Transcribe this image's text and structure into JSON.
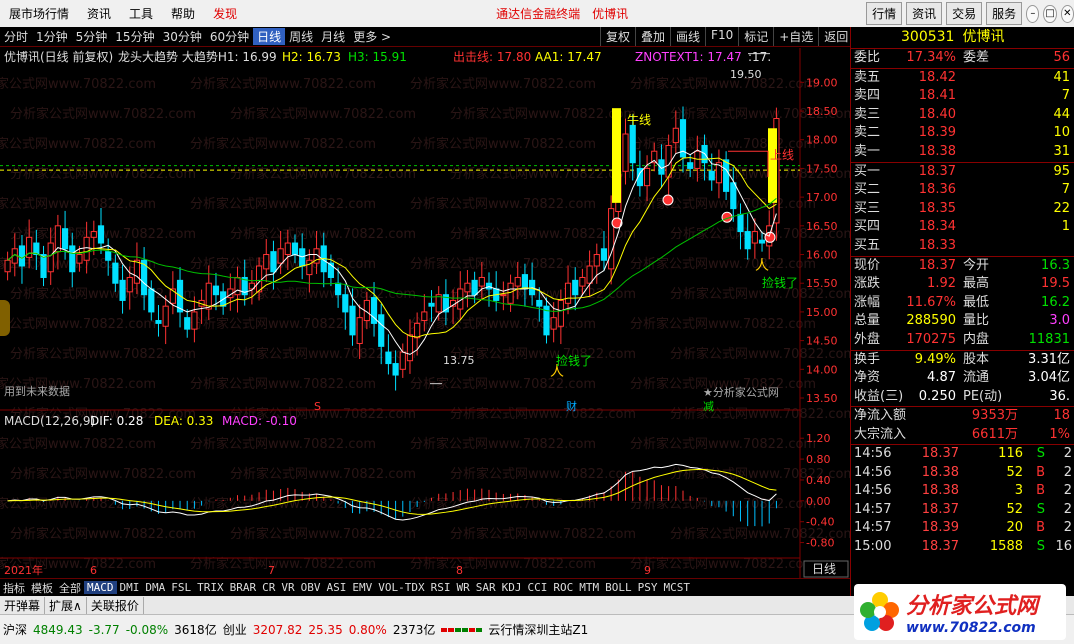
{
  "menubar": {
    "items": [
      "展市场行情",
      "资讯",
      "工具",
      "帮助"
    ],
    "discover": "发现",
    "center_title": "通达信金融终端",
    "center_stock": "优博讯",
    "right_buttons": [
      "行情",
      "资讯",
      "交易",
      "服务"
    ]
  },
  "periodbar": {
    "periods": [
      "分时",
      "1分钟",
      "5分钟",
      "15分钟",
      "30分钟",
      "60分钟",
      "日线",
      "周线",
      "月线",
      "更多 >"
    ],
    "selected": "日线",
    "tools": [
      "复权",
      "叠加",
      "画线",
      "F10",
      "标记",
      "+自选",
      "返回"
    ]
  },
  "chart_info": {
    "title": "优博讯(日线 前复权)",
    "indicator": "龙头大趋势 大趋势H1: 16.99",
    "h2": "H2: 16.73",
    "h3": "H3: 15.91",
    "chuji": "出击线: 17.80",
    "aa1": "AA1: 17.47",
    "znotext": "ZNOTEXT1: 17.47",
    "znotext_trail": ":17.",
    "high_label": "19.50",
    "low_label": "13.75",
    "bull_label": "牛线",
    "rise_label": "上线",
    "jianqian1": "捡钱了",
    "jianqian2": "捡钱了",
    "future_note": "用到未来数据",
    "site_note": "★分析家公式网",
    "mark_s": "S",
    "mark_cai": "财",
    "mark_jian": "减",
    "watermark": "分析家公式网www.70822.com",
    "price_ticks": [
      "19.00",
      "18.50",
      "18.00",
      "17.50",
      "17.00",
      "16.50",
      "16.00",
      "15.50",
      "15.00",
      "14.50",
      "14.00",
      "13.50"
    ]
  },
  "macd": {
    "title": "MACD(12,26,9)",
    "dif": "DIF: 0.28",
    "dea": "DEA: 0.33",
    "macd": "MACD: -0.10",
    "ticks": [
      "1.20",
      "0.80",
      "0.40",
      "0.00",
      "-0.40",
      "-0.80"
    ],
    "x_labels": [
      "2021年",
      "6",
      "7",
      "8",
      "9"
    ],
    "period_label": "日线"
  },
  "tabbar": {
    "tabs": [
      "指标",
      "模板",
      "全部",
      "MACD",
      "DMI",
      "DMA",
      "FSL",
      "TRIX",
      "BRAR",
      "CR",
      "VR",
      "OBV",
      "ASI",
      "EMV",
      "VOL-TDX",
      "RSI",
      "WR",
      "SAR",
      "KDJ",
      "CCI",
      "ROC",
      "MTM",
      "BOLL",
      "PSY",
      "MCST"
    ],
    "selected": "MACD"
  },
  "subbar": {
    "items": [
      "开弹幕",
      "扩展∧",
      "关联报价"
    ]
  },
  "quote": {
    "code": "300531",
    "name": "优博讯",
    "weibi_label": "委比",
    "weibi_value": "17.34%",
    "weicha_label": "委差",
    "weicha_value": "56",
    "asks": [
      {
        "label": "卖五",
        "price": "18.42",
        "vol": "41"
      },
      {
        "label": "卖四",
        "price": "18.41",
        "vol": "7"
      },
      {
        "label": "卖三",
        "price": "18.40",
        "vol": "44"
      },
      {
        "label": "卖二",
        "price": "18.39",
        "vol": "10"
      },
      {
        "label": "卖一",
        "price": "18.38",
        "vol": "31"
      }
    ],
    "bids": [
      {
        "label": "买一",
        "price": "18.37",
        "vol": "95"
      },
      {
        "label": "买二",
        "price": "18.36",
        "vol": "7"
      },
      {
        "label": "买三",
        "price": "18.35",
        "vol": "22"
      },
      {
        "label": "买四",
        "price": "18.34",
        "vol": "1"
      },
      {
        "label": "买五",
        "price": "18.33",
        "vol": ""
      }
    ],
    "stats": [
      {
        "l1": "现价",
        "v1": "18.37",
        "c1": "red",
        "l2": "今开",
        "v2": "16.3",
        "c2": "green"
      },
      {
        "l1": "涨跌",
        "v1": "1.92",
        "c1": "red",
        "l2": "最高",
        "v2": "19.5",
        "c2": "red"
      },
      {
        "l1": "涨幅",
        "v1": "11.67%",
        "c1": "red",
        "l2": "最低",
        "v2": "16.2",
        "c2": "green"
      },
      {
        "l1": "总量",
        "v1": "288590",
        "c1": "yellow",
        "l2": "量比",
        "v2": "3.0",
        "c2": "mag"
      },
      {
        "l1": "外盘",
        "v1": "170275",
        "c1": "red",
        "l2": "内盘",
        "v2": "11831",
        "c2": "green"
      }
    ],
    "stats2": [
      {
        "l1": "换手",
        "v1": "9.49%",
        "c1": "yellow",
        "l2": "股本",
        "v2": "3.31亿",
        "c2": "white"
      },
      {
        "l1": "净资",
        "v1": "4.87",
        "c1": "white",
        "l2": "流通",
        "v2": "3.04亿",
        "c2": "white"
      },
      {
        "l1": "收益(三)",
        "v1": "0.250",
        "c1": "white",
        "l2": "PE(动)",
        "v2": "36.",
        "c2": "white"
      }
    ],
    "flow": [
      {
        "label": "净流入额",
        "value": "9353万",
        "extra": "18"
      },
      {
        "label": "大宗流入",
        "value": "6611万",
        "extra": "1%"
      }
    ],
    "ticks": [
      {
        "time": "14:56",
        "price": "18.37",
        "vol": "116",
        "bs": "S",
        "ex": "2"
      },
      {
        "time": "14:56",
        "price": "18.38",
        "vol": "52",
        "bs": "B",
        "ex": "2"
      },
      {
        "time": "14:56",
        "price": "18.38",
        "vol": "3",
        "bs": "B",
        "ex": "2"
      },
      {
        "time": "14:57",
        "price": "18.37",
        "vol": "52",
        "bs": "S",
        "ex": "2"
      },
      {
        "time": "14:57",
        "price": "18.39",
        "vol": "20",
        "bs": "B",
        "ex": "2"
      },
      {
        "time": "15:00",
        "price": "18.37",
        "vol": "1588",
        "bs": "S",
        "ex": "16"
      }
    ]
  },
  "statusbar": {
    "sh_label": "沪深",
    "sh_value": "4849.43",
    "sh_chg": "-3.77",
    "sh_pct": "-0.08%",
    "sh_amt": "3618亿",
    "cy_label": "创业",
    "cy_value": "3207.82",
    "cy_chg": "25.35",
    "cy_pct": "0.80%",
    "cy_amt": "2373亿",
    "server": "云行情深圳主站Z1"
  },
  "logo": {
    "text1": "分析家公式网",
    "text2": "www.70822.com"
  },
  "colors": {
    "up": "#ff3232",
    "down": "#00e0ff",
    "ma_white": "#ffffff",
    "ma_yellow": "#ffff00",
    "ma_green": "#00c000",
    "dash": "#ffff00",
    "grid": "#800000"
  }
}
